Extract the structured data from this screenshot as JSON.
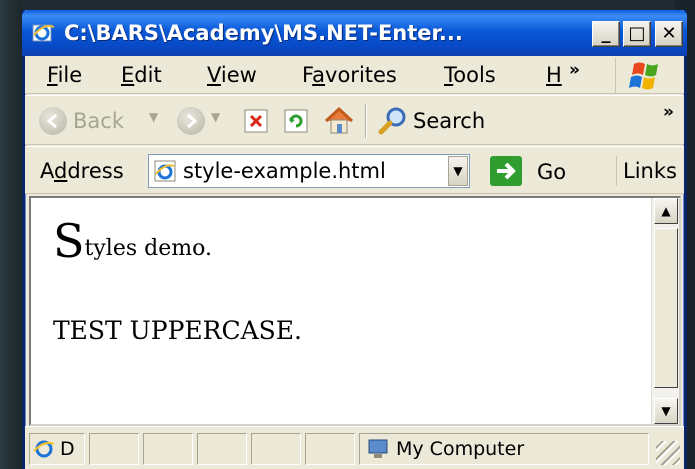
{
  "window": {
    "title": "C:\\BARS\\Academy\\MS.NET-Enter...",
    "controls": {
      "minimize": "_",
      "maximize": "□",
      "close": "✕"
    }
  },
  "menu": {
    "items": [
      {
        "label": "File",
        "accel": "F",
        "rest": "ile"
      },
      {
        "label": "Edit",
        "accel": "E",
        "rest": "dit"
      },
      {
        "label": "View",
        "accel": "V",
        "rest": "iew"
      },
      {
        "label": "Favorites",
        "pre": "F",
        "accel": "a",
        "rest": "vorites"
      },
      {
        "label": "Tools",
        "accel": "T",
        "rest": "ools"
      },
      {
        "label": "H",
        "accel": "H",
        "rest": ""
      }
    ],
    "overflow": "»"
  },
  "toolbar": {
    "back_label": "Back",
    "search_label": "Search",
    "overflow": "»"
  },
  "address": {
    "label_pre": "A",
    "label_accel": "d",
    "label_rest": "dress",
    "value": "style-example.html",
    "go_label": "Go",
    "links_label": "Links"
  },
  "page": {
    "line1_first": "S",
    "line1_rest": "tyles demo.",
    "line2": "TEST UPPERCASE."
  },
  "status": {
    "left_text": "D",
    "zone_text": "My Computer"
  },
  "colors": {
    "title_bar": "#0a59d8",
    "chrome": "#ece9d8",
    "go_green": "#2f9e2f"
  }
}
